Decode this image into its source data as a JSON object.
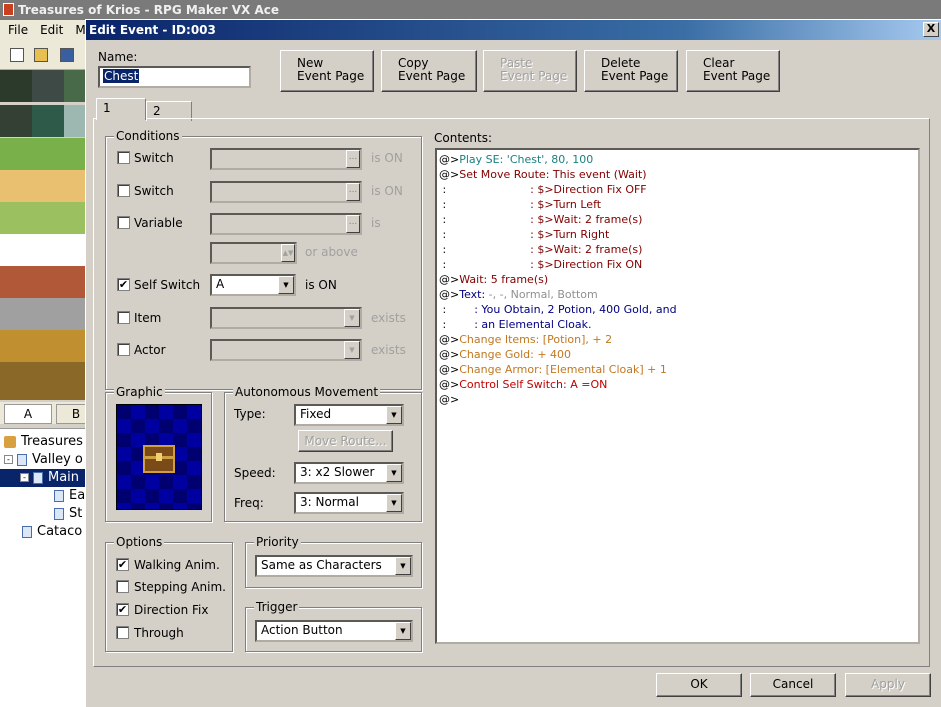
{
  "app": {
    "title": "Treasures of Krios - RPG Maker VX Ace",
    "menu": [
      "File",
      "Edit",
      "Mo"
    ],
    "tileset_tabs": [
      "A",
      "B"
    ],
    "tree": [
      {
        "label": "Treasures",
        "level": 0,
        "kind": "root"
      },
      {
        "label": "Valley o",
        "level": 1,
        "kind": "map",
        "expand": "-"
      },
      {
        "label": "Main",
        "level": 2,
        "kind": "map",
        "expand": "-",
        "selected": true
      },
      {
        "label": "Ea",
        "level": 3,
        "kind": "map"
      },
      {
        "label": "St",
        "level": 3,
        "kind": "map"
      },
      {
        "label": "Cataco",
        "level": 1,
        "kind": "map"
      }
    ]
  },
  "dialog": {
    "title": "Edit Event - ID:003",
    "close_label": "X",
    "name_label": "Name:",
    "name_value": "Chest",
    "buttons": [
      {
        "label": "New\nEvent Page",
        "enabled": true
      },
      {
        "label": "Copy\nEvent Page",
        "enabled": true
      },
      {
        "label": "Paste\nEvent Page",
        "enabled": false
      },
      {
        "label": "Delete\nEvent Page",
        "enabled": true
      },
      {
        "label": "Clear\nEvent Page",
        "enabled": true
      }
    ],
    "tabs": [
      "1",
      "2"
    ],
    "conditions": {
      "title": "Conditions",
      "switch1": {
        "label": "Switch",
        "checked": false,
        "suffix": "is ON"
      },
      "switch2": {
        "label": "Switch",
        "checked": false,
        "suffix": "is ON"
      },
      "variable": {
        "label": "Variable",
        "checked": false,
        "suffix": "is",
        "or_above": "or above"
      },
      "self_switch": {
        "label": "Self Switch",
        "checked": true,
        "value": "A",
        "suffix": "is ON"
      },
      "item": {
        "label": "Item",
        "checked": false,
        "suffix": "exists"
      },
      "actor": {
        "label": "Actor",
        "checked": false,
        "suffix": "exists"
      }
    },
    "graphic": {
      "title": "Graphic"
    },
    "autonomous": {
      "title": "Autonomous Movement",
      "type_label": "Type:",
      "type_value": "Fixed",
      "move_route": "Move Route...",
      "speed_label": "Speed:",
      "speed_value": "3: x2 Slower",
      "freq_label": "Freq:",
      "freq_value": "3: Normal"
    },
    "options": {
      "title": "Options",
      "walking": {
        "label": "Walking Anim.",
        "checked": true
      },
      "stepping": {
        "label": "Stepping Anim.",
        "checked": false
      },
      "direction_fix": {
        "label": "Direction Fix",
        "checked": true
      },
      "through": {
        "label": "Through",
        "checked": false
      }
    },
    "priority": {
      "title": "Priority",
      "value": "Same as Characters"
    },
    "trigger": {
      "title": "Trigger",
      "value": "Action Button"
    },
    "contents_label": "Contents:",
    "contents": [
      [
        {
          "t": "@>",
          "c": "#000"
        },
        {
          "t": "Play SE: 'Chest', 80, 100",
          "c": "#1a8080"
        }
      ],
      [
        {
          "t": "@>",
          "c": "#000"
        },
        {
          "t": "Set Move Route: This event (Wait)",
          "c": "#800000"
        }
      ],
      [
        {
          "t": " :                        ",
          "c": "#000"
        },
        {
          "t": ": $>Direction Fix OFF",
          "c": "#800000"
        }
      ],
      [
        {
          "t": " :                        ",
          "c": "#000"
        },
        {
          "t": ": $>Turn Left",
          "c": "#800000"
        }
      ],
      [
        {
          "t": " :                        ",
          "c": "#000"
        },
        {
          "t": ": $>Wait: 2 frame(s)",
          "c": "#800000"
        }
      ],
      [
        {
          "t": " :                        ",
          "c": "#000"
        },
        {
          "t": ": $>Turn Right",
          "c": "#800000"
        }
      ],
      [
        {
          "t": " :                        ",
          "c": "#000"
        },
        {
          "t": ": $>Wait: 2 frame(s)",
          "c": "#800000"
        }
      ],
      [
        {
          "t": " :                        ",
          "c": "#000"
        },
        {
          "t": ": $>Direction Fix ON",
          "c": "#800000"
        }
      ],
      [
        {
          "t": "@>",
          "c": "#000"
        },
        {
          "t": "Wait: 5 frame(s)",
          "c": "#800000"
        }
      ],
      [
        {
          "t": "@>",
          "c": "#000"
        },
        {
          "t": "Text: ",
          "c": "#000080"
        },
        {
          "t": "-, -, Normal, Bottom",
          "c": "#909090"
        }
      ],
      [
        {
          "t": " :        ",
          "c": "#000"
        },
        {
          "t": ": You Obtain, 2 Potion, 400 Gold, and",
          "c": "#000080"
        }
      ],
      [
        {
          "t": " :        ",
          "c": "#000"
        },
        {
          "t": ": an Elemental Cloak.",
          "c": "#000080"
        }
      ],
      [
        {
          "t": "@>",
          "c": "#000"
        },
        {
          "t": "Change Items: [Potion], + 2",
          "c": "#c07820"
        }
      ],
      [
        {
          "t": "@>",
          "c": "#000"
        },
        {
          "t": "Change Gold: + 400",
          "c": "#c07820"
        }
      ],
      [
        {
          "t": "@>",
          "c": "#000"
        },
        {
          "t": "Change Armor: [Elemental Cloak] + 1",
          "c": "#c07820"
        }
      ],
      [
        {
          "t": "@>",
          "c": "#000"
        },
        {
          "t": "Control Self Switch: A =ON",
          "c": "#c00000"
        }
      ],
      [
        {
          "t": "@>",
          "c": "#000"
        }
      ]
    ],
    "footer": {
      "ok": "OK",
      "cancel": "Cancel",
      "apply": "Apply"
    }
  }
}
